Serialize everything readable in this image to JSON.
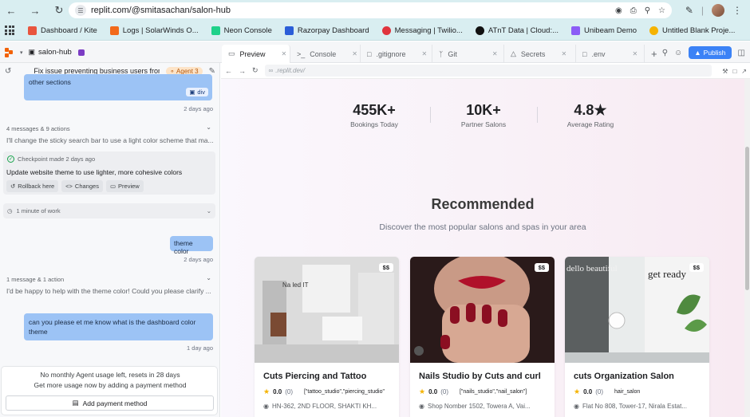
{
  "browser": {
    "url": "replit.com/@smitasachan/salon-hub",
    "bookmarks": [
      {
        "label": "Dashboard / Kite",
        "color": "#e8553e"
      },
      {
        "label": "Logs | SolarWinds O...",
        "color": "#f26a1b"
      },
      {
        "label": "Neon Console",
        "color": "#1fd18a"
      },
      {
        "label": "Razorpay Dashboard",
        "color": "#2b5ed8"
      },
      {
        "label": "Messaging | Twilio...",
        "color": "#e0343d"
      },
      {
        "label": "ATnT Data | Cloud:...",
        "color": "#111111"
      },
      {
        "label": "Unibeam Demo",
        "color": "#8b5cf6"
      },
      {
        "label": "Untitled Blank Proje...",
        "color": "#f5b301"
      }
    ]
  },
  "replit": {
    "project_name": "salon-hub",
    "tabs": [
      {
        "label": "Preview",
        "icon": "monitor-icon"
      },
      {
        "label": "Console",
        "icon": "terminal-icon"
      },
      {
        "label": ".gitignore",
        "icon": "file-icon"
      },
      {
        "label": "Git",
        "icon": "git-icon"
      },
      {
        "label": "Secrets",
        "icon": "lock-icon"
      },
      {
        "label": ".env",
        "icon": "file-icon"
      }
    ],
    "publish_label": "Publish"
  },
  "chat": {
    "title": "Fix issue preventing business users from a...",
    "agent_badge": "Agent 3",
    "msg1_text": "other sections",
    "msg1_chip": "div",
    "msg1_time": "2 days ago",
    "meta1": "4 messages & 9 actions",
    "desc1": "I'll change the sticky search bar to use a light color scheme that ma...",
    "checkpoint_meta": "Checkpoint made 2 days ago",
    "checkpoint_title": "Update website theme to use lighter, more cohesive colors",
    "cp_buttons": [
      "Rollback here",
      "Changes",
      "Preview"
    ],
    "work_label": "1 minute of work",
    "msg2_text": "theme color",
    "msg2_time": "2 days ago",
    "meta2": "1 message & 1 action",
    "desc2": "I'd be happy to help with the theme color! Could you please clarify ...",
    "msg3_text": "can you please et me know what is the dashboard color theme",
    "msg3_time": "1 day ago",
    "footer_line1": "No monthly Agent usage left, resets in 28 days",
    "footer_line2": "Get more usage now by adding a payment method",
    "pay_button": "Add payment method"
  },
  "preview": {
    "address": ".replit.dev/",
    "stats": [
      {
        "value": "455K+",
        "label": "Bookings Today"
      },
      {
        "value": "10K+",
        "label": "Partner Salons"
      },
      {
        "value": "4.8★",
        "label": "Average Rating"
      }
    ],
    "section_title": "Recommended",
    "section_subtitle": "Discover the most popular salons and spas in your area",
    "salons": [
      {
        "name": "Cuts Piercing and Tattoo",
        "price": "$$",
        "rating": "0.0",
        "count": "(0)",
        "tags": "[\"tattoo_studio\",\"piercing_studio\"",
        "address": "HN-362, 2ND FLOOR, SHAKTI KH..."
      },
      {
        "name": "Nails Studio by Cuts and curl",
        "price": "$$",
        "rating": "0.0",
        "count": "(0)",
        "tags": "[\"nails_studio\",\"nail_salon\"]",
        "address": "Shop Nomber 1502, Towera A, Vai..."
      },
      {
        "name": "cuts Organization Salon",
        "price": "$$",
        "rating": "0.0",
        "count": "(0)",
        "tags": "hair_salon",
        "address": "Flat No 808, Tower-17, Nirala Estat..."
      }
    ]
  }
}
